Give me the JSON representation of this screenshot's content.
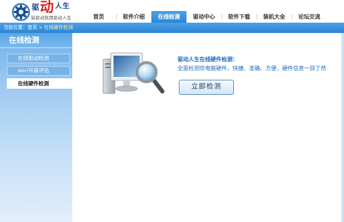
{
  "header": {
    "logo": {
      "icon": "gear-logo-icon",
      "name_chars": [
        "驱",
        "动",
        "人",
        "生"
      ],
      "slogan": "装驱动就用驱动人生"
    },
    "nav": [
      {
        "label": "首页",
        "active": false
      },
      {
        "label": "软件介绍",
        "active": false
      },
      {
        "label": "在线检测",
        "active": true
      },
      {
        "label": "驱动中心",
        "active": false
      },
      {
        "label": "软件下载",
        "active": false
      },
      {
        "label": "装机大全",
        "active": false
      },
      {
        "label": "论坛交流",
        "active": false
      }
    ]
  },
  "breadcrumb": {
    "prefix": "当前位置：",
    "home": "首页",
    "separator": "»",
    "current": "在线硬件检测"
  },
  "sidebar": {
    "title": "在线检测",
    "items": [
      {
        "label": "在线驱动检测",
        "active": false
      },
      {
        "label": "win7升级评估",
        "active": false
      },
      {
        "label": "在线硬件检测",
        "active": true
      }
    ]
  },
  "main": {
    "illustration_icon": "computer-magnifier-icon",
    "heading": "驱动人生在线硬件检测：",
    "description": "全面检测您电脑硬件，快捷、准确、方便，硬件信息一目了然",
    "detect_button": "立即检测"
  },
  "colors": {
    "primary_blue": "#2b86d6",
    "text_blue": "#1c6dc2",
    "logo_red": "#d9261c",
    "logo_navy": "#1b4c8a"
  }
}
